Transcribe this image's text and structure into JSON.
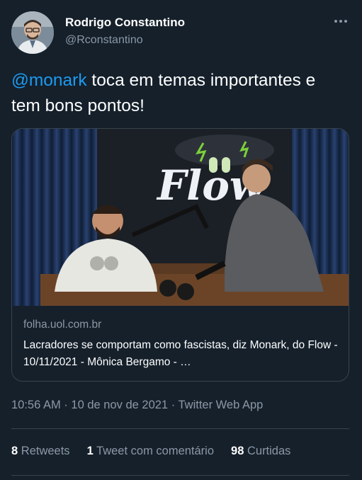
{
  "author": {
    "display_name": "Rodrigo Constantino",
    "handle": "@Rconstantino"
  },
  "tweet": {
    "mention": "@monark",
    "text_after_mention": " toca em temas importantes e tem bons pontos!"
  },
  "card": {
    "domain": "folha.uol.com.br",
    "title": "Lacradores se comportam como fascistas, diz Monark, do Flow - 10/11/2021 - Mônica Bergamo - …",
    "image_logo_text": "Flow"
  },
  "meta": {
    "time": "10:56 AM",
    "separator1": " · ",
    "date": "10 de nov de 2021",
    "separator2": " · ",
    "source": "Twitter Web App"
  },
  "stats": {
    "retweets_count": "8",
    "retweets_label": " Retweets",
    "quotes_count": "1",
    "quotes_label": " Tweet com comentário",
    "likes_count": "98",
    "likes_label": " Curtidas"
  },
  "colors": {
    "background": "#15202b",
    "accent": "#1d9bf0",
    "secondary_text": "#8b98a5",
    "border": "#38444d"
  },
  "icons": {
    "more": "more-horizontal-icon"
  }
}
